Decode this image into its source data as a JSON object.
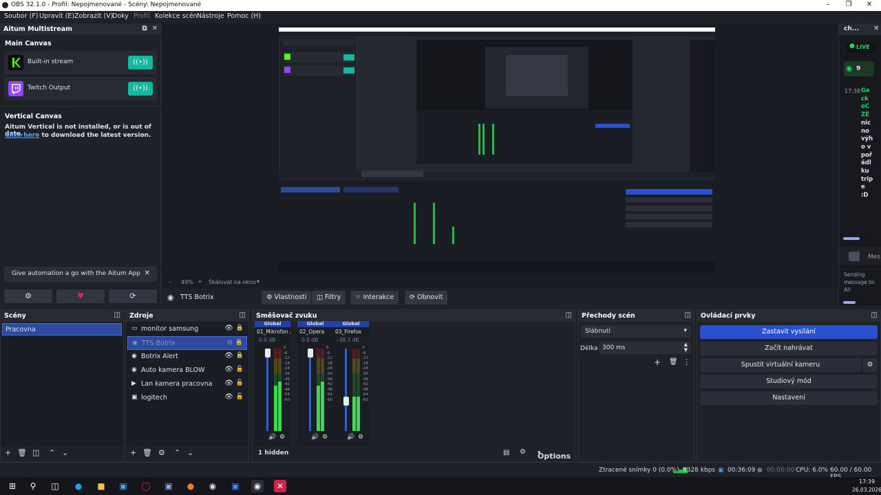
{
  "titlebar": {
    "title": "OBS 32.1.0 - Profil: Nepojmenované - Scény: Nepojmenované"
  },
  "menu": {
    "items": [
      "Soubor (F)",
      "Upravit (E)",
      "Zobrazit (V)",
      "Doky",
      "Profil",
      "Kolekce scén",
      "Nástroje",
      "Pomoc (H)"
    ]
  },
  "aitum": {
    "title": "Aitum Multistream",
    "main_canvas": "Main Canvas",
    "outputs": [
      {
        "label": "Built-in stream",
        "logo": "kick-logo",
        "color": "#53fc18",
        "button_icon": "broadcast-icon"
      },
      {
        "label": "Twitch Output",
        "logo": "twitch-logo",
        "color": "#9146ff",
        "button_icon": "broadcast-icon"
      }
    ],
    "vertical_canvas": "Vertical Canvas",
    "vertical_msg_1": "Aitum Vertical is not installed, or is out of date.",
    "vertical_link": "Click here",
    "vertical_msg_2": "to download the latest version.",
    "automation_tip": "Give automation a go with the Aitum App"
  },
  "preview": {
    "zoom": "49%",
    "scale_label": "Škálovat na okno",
    "nested_label": "Recursive OBS preview (screen capture of itself)"
  },
  "source_toolbar": {
    "selected_source": "TTS Botrix",
    "buttons": [
      "Vlastnosti",
      "Filtry",
      "Interakce",
      "Obnovit"
    ]
  },
  "chat": {
    "channel": "ch...",
    "live": "LIVE",
    "viewers": "9",
    "time": "17:38",
    "lines": [
      "Ge",
      "ck",
      "oC",
      "ZE",
      "nic",
      "no",
      "výh",
      "o v",
      "poř",
      "ádl",
      "ku",
      "trip",
      "e",
      ":D"
    ],
    "input_placeholder": "Mes",
    "sending": "Sending message to: All"
  },
  "scenes": {
    "title": "Scény",
    "items": [
      "Pracovna"
    ]
  },
  "sources": {
    "title": "Zdroje",
    "items": [
      {
        "name": "monitor samsung",
        "icon": "monitor-icon"
      },
      {
        "name": "TTS Botrix",
        "icon": "browser-icon",
        "selected": true
      },
      {
        "name": "Botrix Alert",
        "icon": "browser-icon"
      },
      {
        "name": "Auto kamera BLOW",
        "icon": "browser-icon"
      },
      {
        "name": "Lan kamera pracovna",
        "icon": "media-icon"
      },
      {
        "name": "logitech",
        "icon": "camera-icon"
      }
    ]
  },
  "mixer": {
    "title": "Směšovač zvuku",
    "channels": [
      {
        "tag": "Global",
        "name": "01_Mikrofon / Al",
        "db": "0.0 dB",
        "level": 1.0
      },
      {
        "tag": "Global",
        "name": "02_Opera",
        "db": "0.0 dB",
        "level": 1.0
      },
      {
        "tag": "Global",
        "name": "03_Firefox",
        "db": "-38.3 dB",
        "level": 0.35
      }
    ],
    "scale": [
      "0",
      "-6",
      "-12",
      "-18",
      "-24",
      "-30",
      "-36",
      "-42",
      "-48",
      "-54",
      "-60"
    ],
    "hidden": "1 hidden",
    "options": "Options"
  },
  "transitions": {
    "title": "Přechody scén",
    "type": "Slábnutí",
    "duration_label": "Délka",
    "duration": "300 ms"
  },
  "controls": {
    "title": "Ovládací prvky",
    "buttons": [
      "Zastavit vysílání",
      "Začít nahrávat",
      "Spustit virtuální kameru",
      "Studiový mód",
      "Nastavení"
    ]
  },
  "status": {
    "dropped": "Ztracené snímky 0 (0.0%)",
    "bitrate": "8328 kbps",
    "stream_time": "00:36:09",
    "rec_time": "00:00:00",
    "cpu": "CPU: 6.0%",
    "fps": "60.00 / 60.00 FPS"
  },
  "taskbar": {
    "time": "17:39",
    "date": "26.03.2026"
  },
  "colors": {
    "accent": "#2b4fd1",
    "aitum_button": "#14b8a0",
    "live": "#1ed760",
    "bg": "#1f2129"
  }
}
